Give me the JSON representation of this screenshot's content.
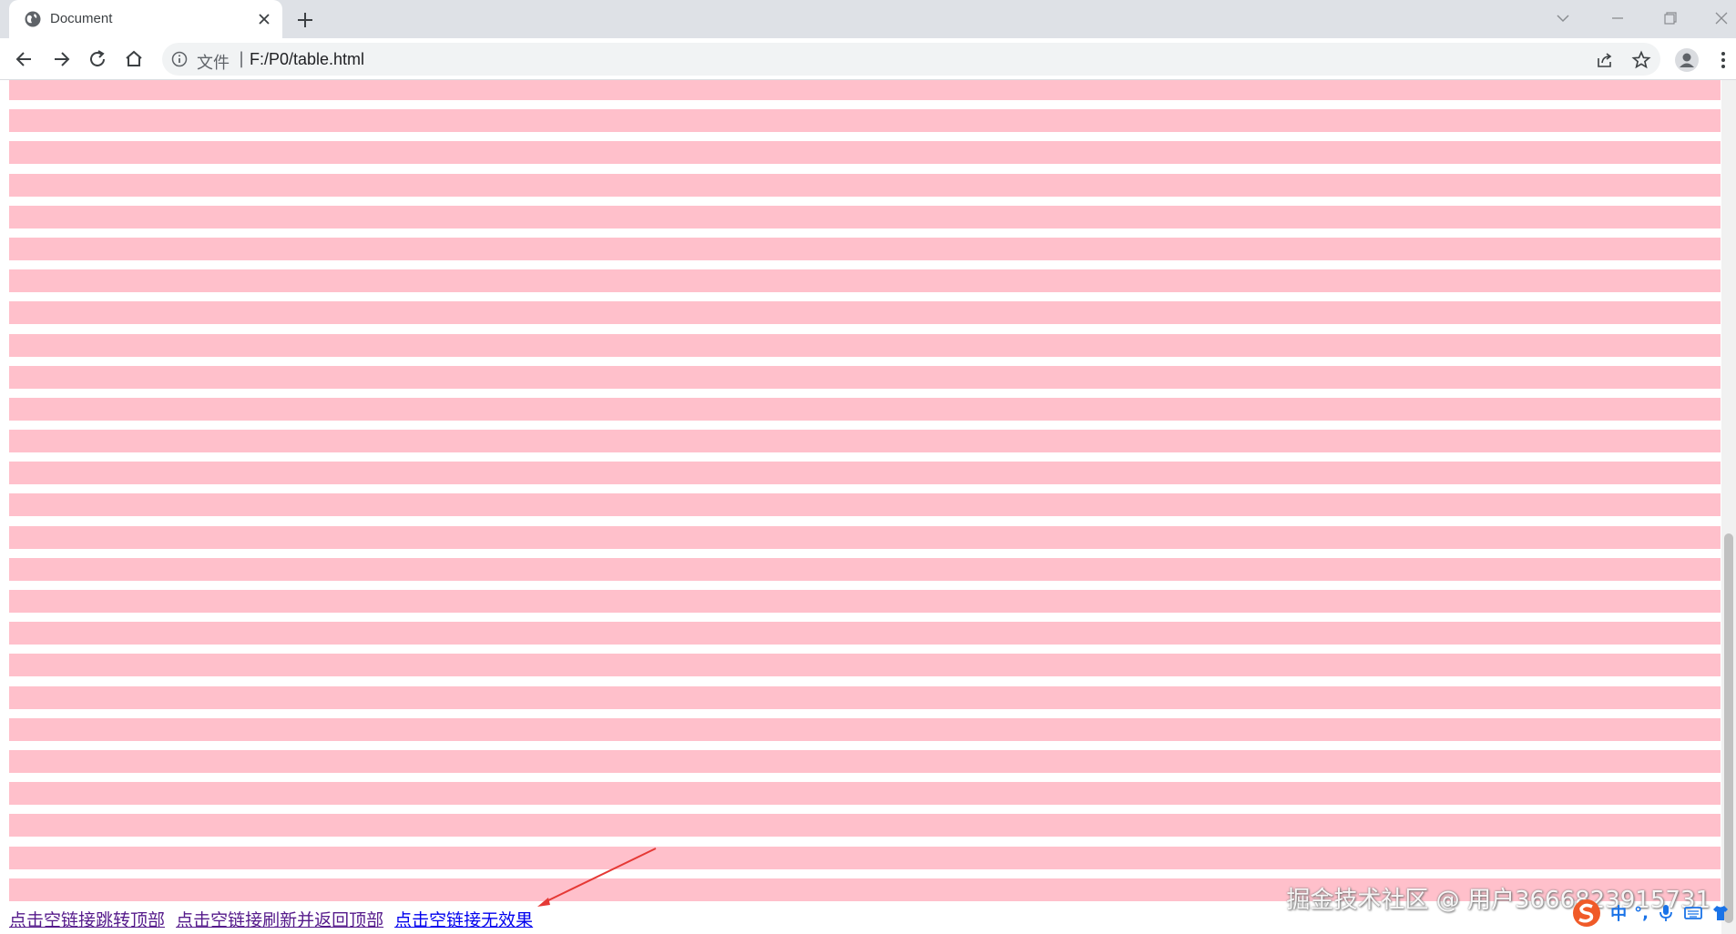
{
  "browser": {
    "tab_title": "Document",
    "omnibox_scheme": "文件",
    "omnibox_separator": "|",
    "url": "F:/P0/table.html"
  },
  "page": {
    "row_count": 26,
    "row_color": "#ffc0cb",
    "links": [
      {
        "label": "点击空链接跳转顶部",
        "state": "visited"
      },
      {
        "label": "点击空链接刷新并返回顶部",
        "state": "visited"
      },
      {
        "label": "点击空链接无效果",
        "state": "unvisited"
      }
    ]
  },
  "watermark": "掘金技术社区 @ 用户3666823915731",
  "ime": {
    "lang_label": "中",
    "punct_label": "°,"
  },
  "icons": [
    "globe-icon",
    "close-icon",
    "plus-icon",
    "back-icon",
    "forward-icon",
    "reload-icon",
    "home-icon",
    "info-icon",
    "share-icon",
    "star-icon",
    "profile-icon",
    "menu-icon",
    "mic-icon",
    "keyboard-icon",
    "shirt-icon"
  ]
}
